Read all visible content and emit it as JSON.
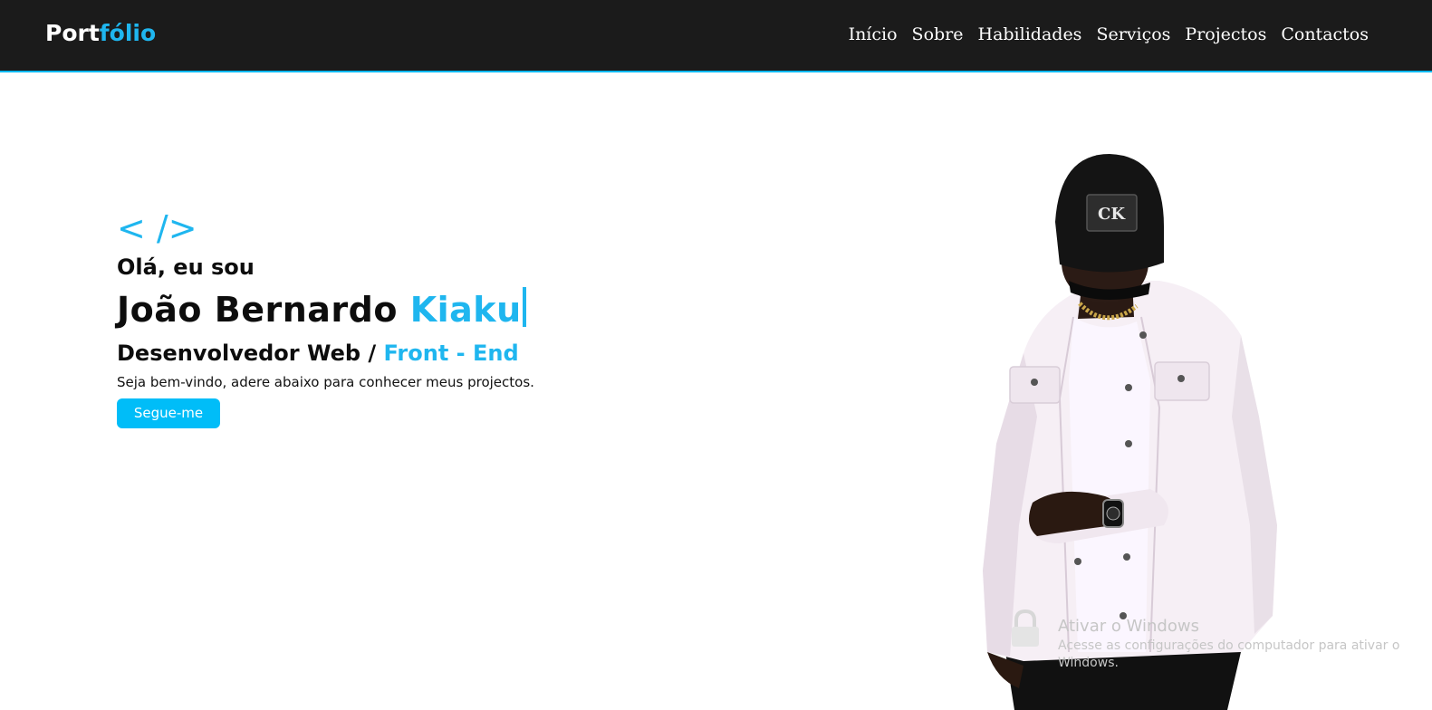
{
  "navbar": {
    "logo_part1": "Port",
    "logo_part2": "fólio",
    "links": [
      "Início",
      "Sobre",
      "Habilidades",
      "Serviços",
      "Projectos",
      "Contactos"
    ]
  },
  "hero": {
    "code_tag": "< />",
    "greeting": "Olá, eu sou",
    "name_first": "João Bernardo ",
    "name_typed": "Kiaku",
    "role_main": "Desenvolvedor Web / ",
    "role_accent": "Front - End",
    "welcome": "Seja bem-vindo, adere abaixo para conhecer meus projectos.",
    "button_label": "Segue-me"
  },
  "cap": {
    "logo_text": "CK"
  },
  "watermark": {
    "title": "Ativar o Windows",
    "subtitle": "Acesse as configurações do computador para ativar o Windows."
  },
  "colors": {
    "accent": "#1fb6ef",
    "navbar_bg": "#1b1b1b",
    "button_bg": "#00bdf8"
  }
}
